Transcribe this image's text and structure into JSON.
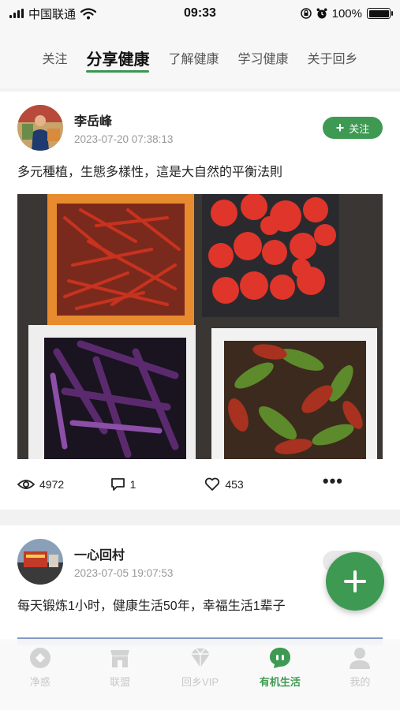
{
  "status": {
    "carrier": "中国联通",
    "time": "09:33",
    "battery": "100%"
  },
  "tabs": [
    {
      "label": "关注",
      "active": false
    },
    {
      "label": "分享健康",
      "active": true
    },
    {
      "label": "了解健康",
      "active": false
    },
    {
      "label": "学习健康",
      "active": false
    },
    {
      "label": "关于回乡",
      "active": false
    }
  ],
  "posts": [
    {
      "user": "李岳峰",
      "time": "2023-07-20 07:38:13",
      "follow_label": "关注",
      "text": "多元種植，生態多樣性，這是大自然的平衡法則",
      "views": "4972",
      "comments": "1",
      "likes": "453"
    },
    {
      "user": "一心回村",
      "time": "2023-07-05 19:07:53",
      "text": "每天锻炼1小时，健康生活50年，幸福生活1辈子"
    }
  ],
  "bottom_nav": [
    {
      "label": "净惑",
      "icon": "shield-icon",
      "active": false
    },
    {
      "label": "联盟",
      "icon": "store-icon",
      "active": false
    },
    {
      "label": "回乡VIP",
      "icon": "diamond-icon",
      "active": false
    },
    {
      "label": "有机生活",
      "icon": "chat-bubble-icon",
      "active": true
    },
    {
      "label": "我的",
      "icon": "person-icon",
      "active": false
    }
  ],
  "colors": {
    "accent": "#3e9a52",
    "active_nav": "#3e9a52",
    "inactive_nav": "#c8c8c8"
  }
}
